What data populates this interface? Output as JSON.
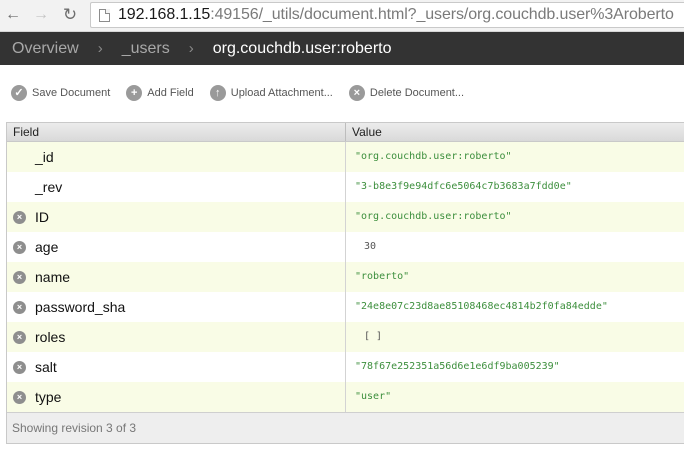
{
  "browser": {
    "url_host": "192.168.1.15",
    "url_rest": ":49156/_utils/document.html?_users/org.couchdb.user%3Aroberto"
  },
  "breadcrumb": {
    "items": [
      "Overview",
      "_users",
      "org.couchdb.user:roberto"
    ],
    "separator": "›"
  },
  "toolbar": {
    "save_label": "Save Document",
    "add_label": "Add Field",
    "upload_label": "Upload Attachment...",
    "delete_label": "Delete Document..."
  },
  "table": {
    "headers": [
      "Field",
      "Value"
    ],
    "rows": [
      {
        "field": "_id",
        "value": "\"org.couchdb.user:roberto\"",
        "deletable": false
      },
      {
        "field": "_rev",
        "value": "\"3-b8e3f9e94dfc6e5064c7b3683a7fdd0e\"",
        "deletable": false
      },
      {
        "field": "ID",
        "value": "\"org.couchdb.user:roberto\"",
        "deletable": true
      },
      {
        "field": "age",
        "value": "30",
        "deletable": true
      },
      {
        "field": "name",
        "value": "\"roberto\"",
        "deletable": true
      },
      {
        "field": "password_sha",
        "value": "\"24e8e07c23d8ae85108468ec4814b2f0fa84edde\"",
        "deletable": true
      },
      {
        "field": "roles",
        "value": "[ ]",
        "deletable": true
      },
      {
        "field": "salt",
        "value": "\"78f67e252351a56d6e1e6df9ba005239\"",
        "deletable": true
      },
      {
        "field": "type",
        "value": "\"user\"",
        "deletable": true
      }
    ]
  },
  "status": {
    "text": "Showing revision 3 of 3"
  },
  "colors": {
    "crumb_bg": "#333333",
    "value_green": "#3d8f3d",
    "row_tint": "#f9fce6"
  }
}
